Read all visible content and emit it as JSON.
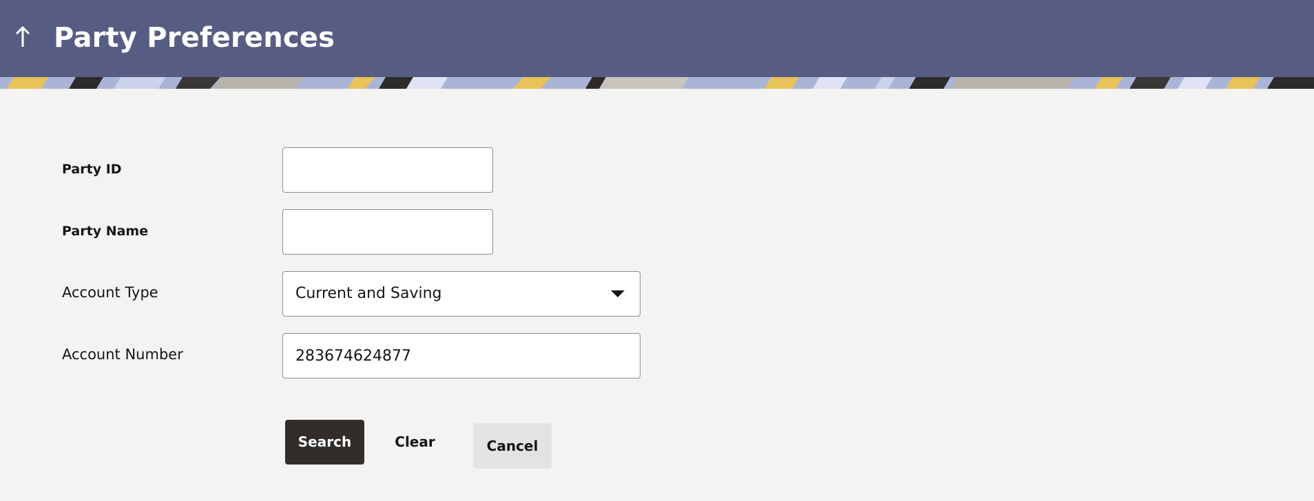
{
  "header": {
    "title": "Party Preferences",
    "back_icon": "arrow-up-icon",
    "background_color": "#575d82"
  },
  "form": {
    "party_id": {
      "label": "Party ID",
      "value": "",
      "placeholder": ""
    },
    "party_name": {
      "label": "Party Name",
      "value": "",
      "placeholder": ""
    },
    "account_type": {
      "label": "Account Type",
      "selected": "Current and Saving"
    },
    "account_number": {
      "label": "Account Number",
      "value": "283674624877"
    }
  },
  "actions": {
    "search_label": "Search",
    "clear_label": "Clear",
    "cancel_label": "Cancel"
  }
}
